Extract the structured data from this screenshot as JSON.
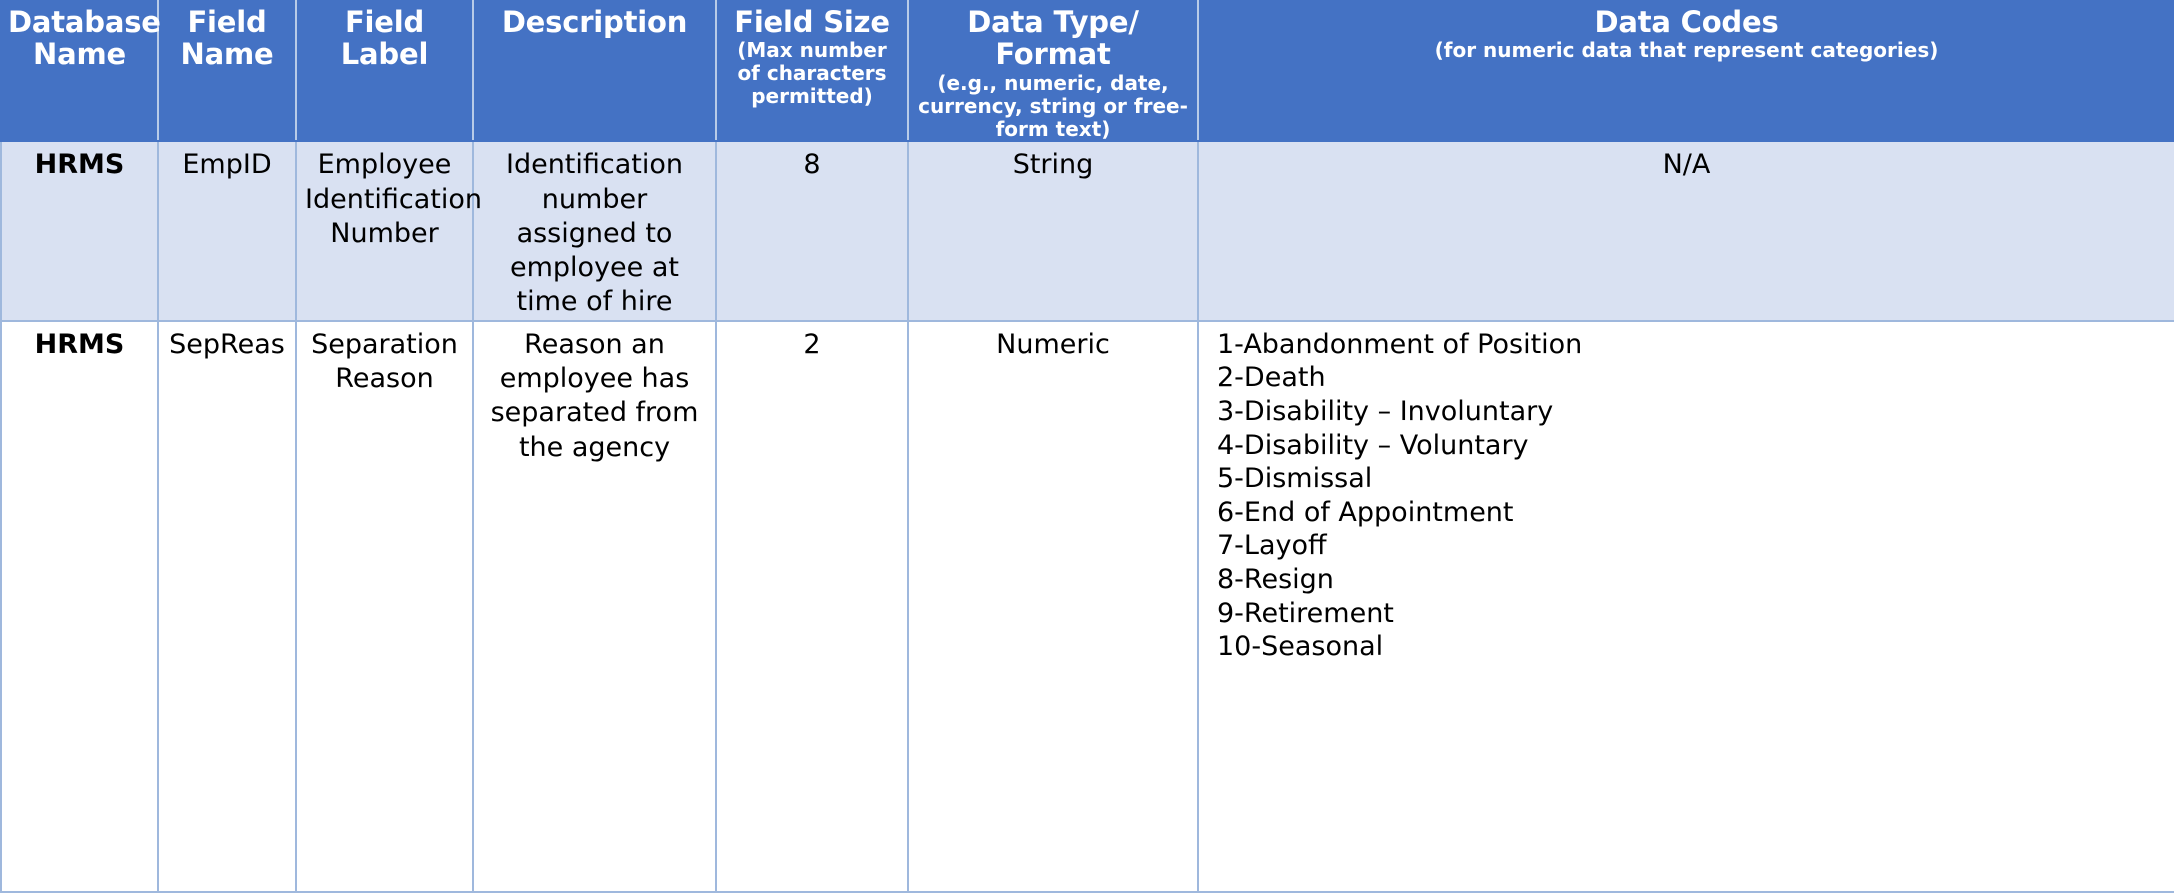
{
  "table": {
    "columns": [
      {
        "key": "database_name",
        "main": "Database Name",
        "sub": ""
      },
      {
        "key": "field_name",
        "main": "Field Name",
        "sub": ""
      },
      {
        "key": "field_label",
        "main": "Field Label",
        "sub": ""
      },
      {
        "key": "description",
        "main": "Description",
        "sub": ""
      },
      {
        "key": "field_size",
        "main": "Field Size",
        "sub": "(Max number of characters permitted)"
      },
      {
        "key": "data_type",
        "main": "Data Type/ Format",
        "sub": "(e.g., numeric, date, currency, string or free-form text)"
      },
      {
        "key": "data_codes",
        "main": "Data Codes",
        "sub": "(for numeric data that represent categories)"
      }
    ],
    "rows": [
      {
        "database_name": "HRMS",
        "field_name": "EmpID",
        "field_label": "Employee Identification Number",
        "description": "Identification number assigned to employee at time of hire",
        "field_size": "8",
        "data_type": "String",
        "data_codes_text": "N/A",
        "data_codes_list": []
      },
      {
        "database_name": "HRMS",
        "field_name": "SepReas",
        "field_label": "Separation Reason",
        "description": "Reason an employee has separated from the agency",
        "field_size": "2",
        "data_type": "Numeric",
        "data_codes_text": "",
        "data_codes_list": [
          "1-Abandonment of Position",
          "2-Death",
          "3-Disability – Involuntary",
          "4-Disability – Voluntary",
          "5-Dismissal",
          "6-End of Appointment",
          "7-Layoff",
          "8-Resign",
          "9-Retirement",
          "10-Seasonal"
        ]
      }
    ]
  },
  "colors": {
    "header_background": "#4472C4",
    "header_text": "#FFFFFF",
    "row_shaded_background": "#D9E1F2",
    "row_plain_background": "#FFFFFF",
    "cell_border": "#9FB8DD",
    "body_text": "#000000"
  }
}
